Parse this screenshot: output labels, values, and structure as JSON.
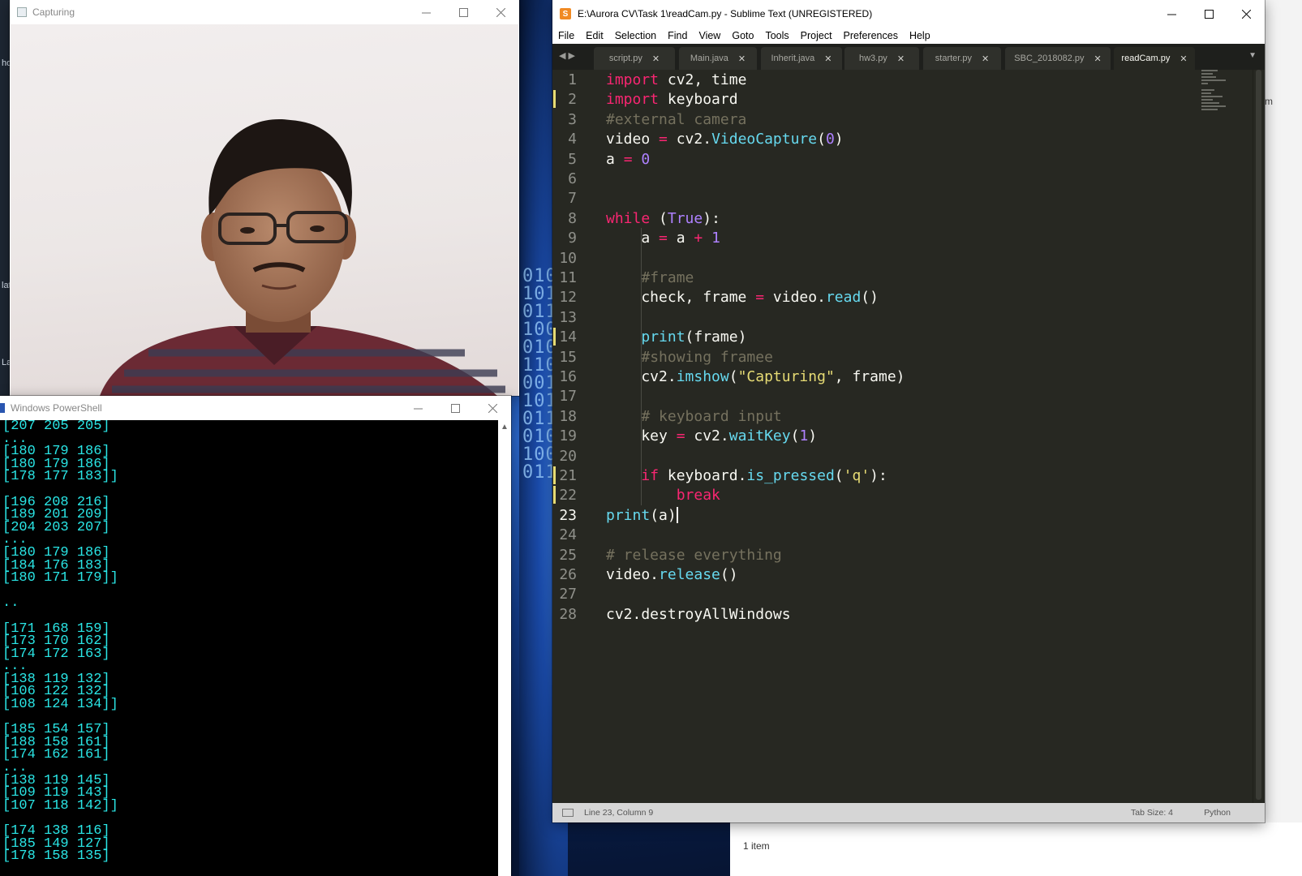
{
  "capturing_window": {
    "title": "Capturing"
  },
  "powershell": {
    "title": "Windows PowerShell",
    "lines": [
      "[207 205 205]",
      "...",
      "[180 179 186]",
      "[180 179 186]",
      "[178 177 183]]",
      "",
      "[196 208 216]",
      "[189 201 209]",
      "[204 203 207]",
      "...",
      "[180 179 186]",
      "[184 176 183]",
      "[180 171 179]]",
      "",
      "..",
      "",
      "[171 168 159]",
      "[173 170 162]",
      "[174 172 163]",
      "...",
      "[138 119 132]",
      "[106 122 132]",
      "[108 124 134]]",
      "",
      "[185 154 157]",
      "[188 158 161]",
      "[174 162 161]",
      "...",
      "[138 119 145]",
      "[109 119 143]",
      "[107 118 142]]",
      "",
      "[174 138 116]",
      "[185 149 127]",
      "[178 158 135]"
    ]
  },
  "sublime": {
    "title": "E:\\Aurora CV\\Task 1\\readCam.py - Sublime Text (UNREGISTERED)",
    "menu": [
      "File",
      "Edit",
      "Selection",
      "Find",
      "View",
      "Goto",
      "Tools",
      "Project",
      "Preferences",
      "Help"
    ],
    "tabs": [
      {
        "label": "script.py",
        "active": false
      },
      {
        "label": "Main.java",
        "active": false
      },
      {
        "label": "Inherit.java",
        "active": false
      },
      {
        "label": "hw3.py",
        "active": false
      },
      {
        "label": "starter.py",
        "active": false
      },
      {
        "label": "SBC_2018082.py",
        "active": false
      },
      {
        "label": "readCam.py",
        "active": true
      }
    ],
    "code_lines": [
      "import cv2, time",
      "import keyboard",
      "#external camera",
      "video = cv2.VideoCapture(0)",
      "a = 0",
      "",
      "",
      "while (True):",
      "    a = a + 1",
      "",
      "    #frame",
      "    check, frame = video.read()",
      "",
      "    print(frame)",
      "    #showing framee",
      "    cv2.imshow(\"Capturing\", frame)",
      "",
      "    # keyboard input",
      "    key = cv2.waitKey(1)",
      "",
      "    if keyboard.is_pressed('q'):",
      "        break",
      "print(a)",
      "",
      "# release everything",
      "video.release()",
      "",
      "cv2.destroyAllWindows"
    ],
    "modified_lines": [
      2,
      14,
      21,
      22
    ],
    "current_line": 23,
    "status": {
      "position": "Line 23, Column 9",
      "tab_size": "Tab Size: 4",
      "syntax": "Python"
    }
  },
  "explorer": {
    "item_count": "1 item"
  },
  "colors": {
    "editor_bg": "#272822",
    "keyword": "#f92672",
    "function": "#66d9ef",
    "number": "#ae81ff",
    "string": "#e6db74",
    "comment": "#75715e",
    "console_text": "#2ae6e6"
  }
}
